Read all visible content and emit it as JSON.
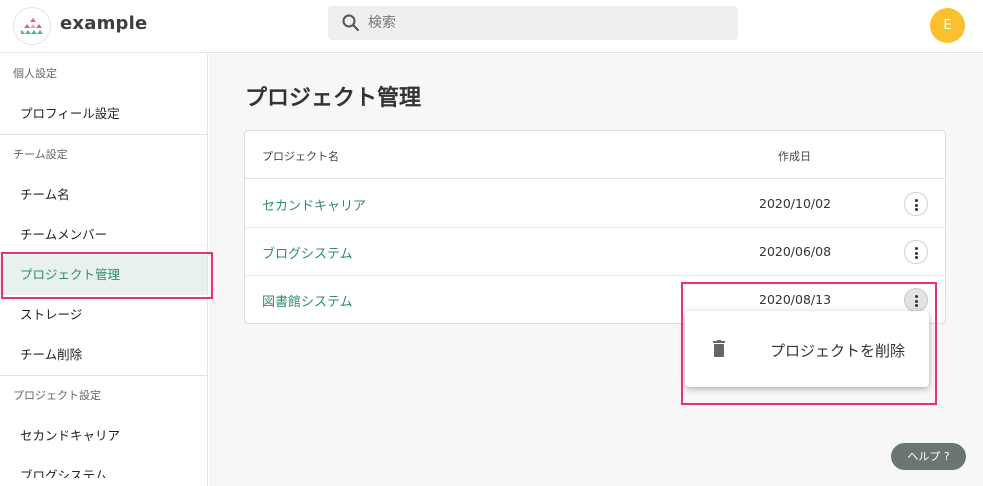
{
  "header": {
    "brand": "example",
    "search_placeholder": "検索",
    "avatar_initial": "E"
  },
  "sidebar": {
    "personal_section": "個人設定",
    "profile_item": "プロフィール設定",
    "team_section": "チーム設定",
    "team_items": [
      "チーム名",
      "チームメンバー",
      "プロジェクト管理",
      "ストレージ",
      "チーム削除"
    ],
    "project_section": "プロジェクト設定",
    "project_items": [
      "セカンドキャリア",
      "ブログシステム"
    ]
  },
  "main": {
    "title": "プロジェクト管理",
    "table": {
      "columns": [
        "プロジェクト名",
        "作成日"
      ],
      "rows": [
        {
          "name": "セカンドキャリア",
          "date": "2020/10/02"
        },
        {
          "name": "ブログシステム",
          "date": "2020/06/08"
        },
        {
          "name": "図書館システム",
          "date": "2020/08/13"
        }
      ]
    },
    "menu": {
      "delete_label": "プロジェクトを削除"
    }
  },
  "help_label": "ヘルプ ?",
  "colors": {
    "accent": "#2e8c74",
    "highlight": "#e8336b",
    "avatar": "#fbc02d"
  }
}
